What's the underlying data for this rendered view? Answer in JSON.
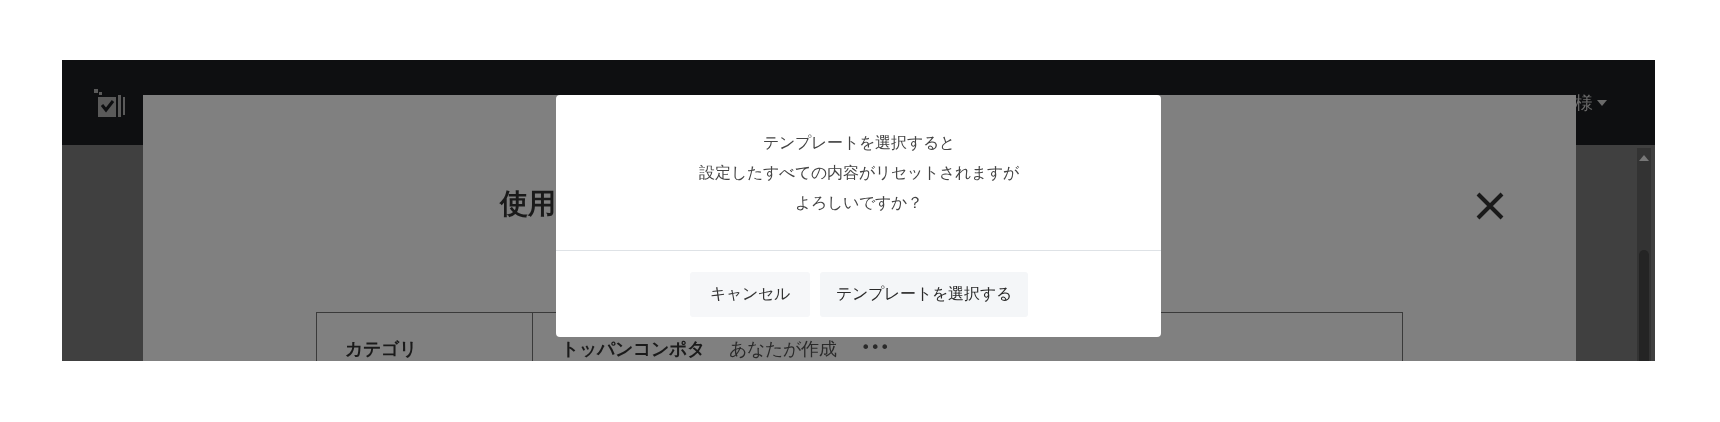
{
  "header": {
    "user_name": "様"
  },
  "modal": {
    "title": "使用",
    "table": {
      "rows": [
        {
          "label": "カテゴリ",
          "value": "トッパンコンポタ",
          "author": "あなたが作成",
          "more": "•••"
        }
      ]
    }
  },
  "dialog": {
    "message_lines": [
      "テンプレートを選択すると",
      "設定したすべての内容がリセットされますが",
      "よろしいですか？"
    ],
    "buttons": [
      {
        "label": "キャンセル",
        "kind": "cancel"
      },
      {
        "label": "テンプレートを選択する",
        "kind": "confirm"
      }
    ]
  }
}
